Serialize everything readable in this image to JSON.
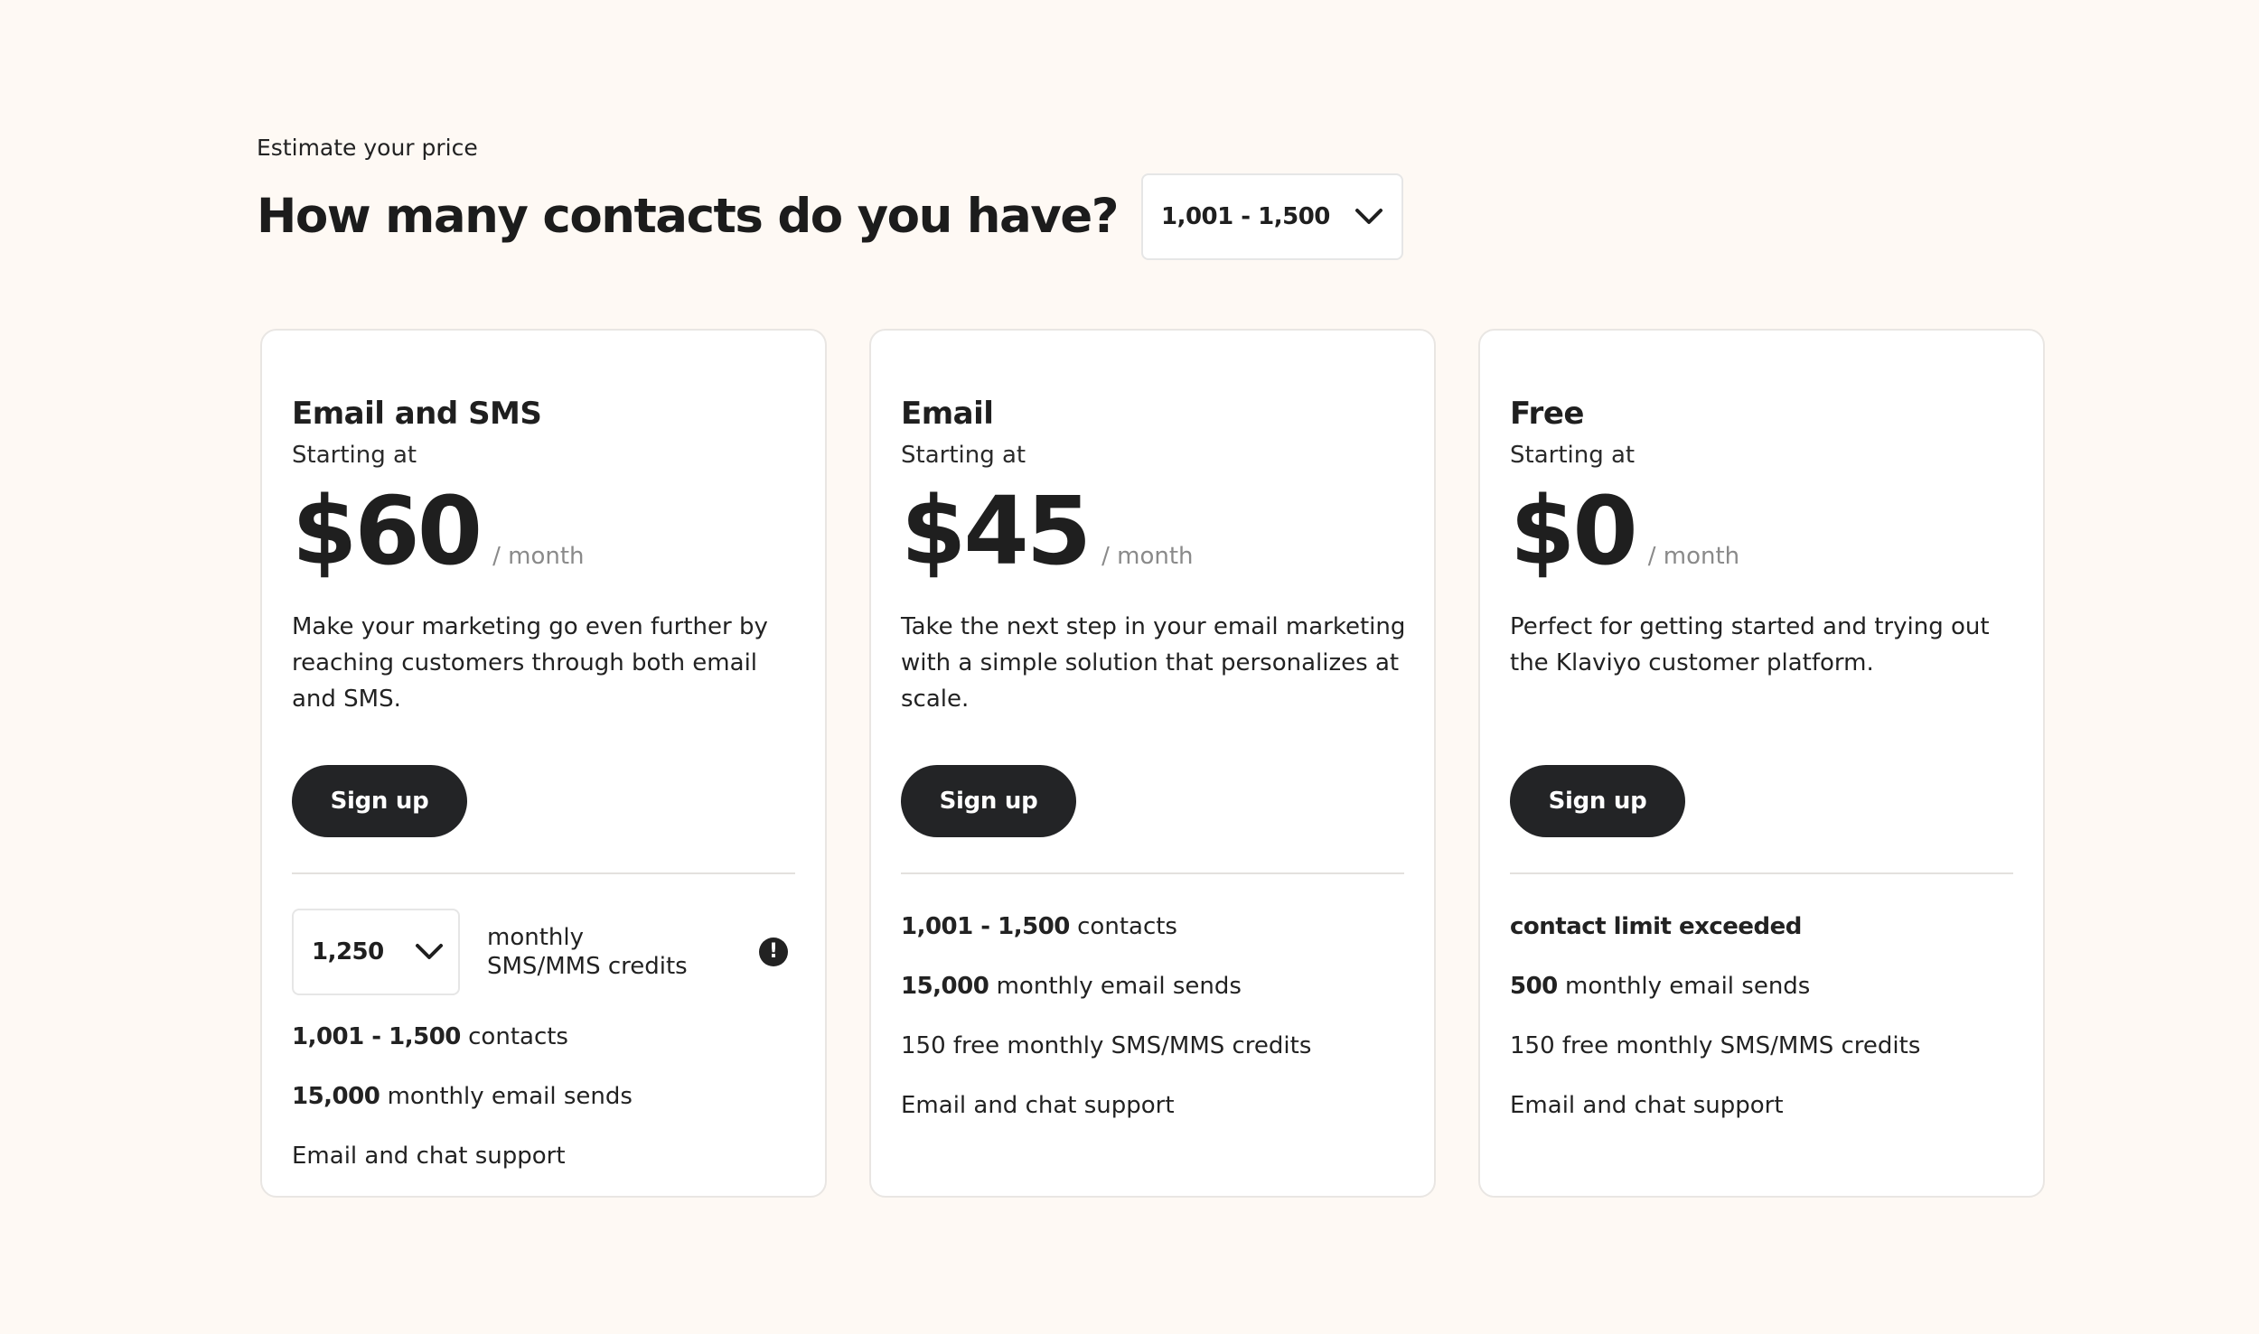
{
  "header": {
    "eyebrow": "Estimate your price",
    "title": "How many contacts do you have?",
    "contacts_select": {
      "value": "1,001 - 1,500",
      "icon": "chevron-down-icon"
    }
  },
  "cards": [
    {
      "name": "Email and SMS",
      "starting": "Starting at",
      "price": "$60",
      "per": "/ month",
      "description": "Make your marketing go even further by reaching customers through both email and SMS.",
      "cta": "Sign up",
      "sms": {
        "value": "1,250",
        "label": "monthly SMS/MMS credits",
        "info_glyph": "!",
        "info_icon": "info-icon"
      },
      "features": [
        {
          "bold": "1,001 - 1,500",
          "text": " contacts"
        },
        {
          "bold": "15,000",
          "text": " monthly email sends"
        },
        {
          "bold": "",
          "text": "Email and chat support"
        }
      ]
    },
    {
      "name": "Email",
      "starting": "Starting at",
      "price": "$45",
      "per": "/ month",
      "description": "Take the next step in your email marketing with a simple solution that personalizes at scale.",
      "cta": "Sign up",
      "features": [
        {
          "bold": "1,001 - 1,500",
          "text": " contacts"
        },
        {
          "bold": "15,000",
          "text": " monthly email sends"
        },
        {
          "bold": "",
          "text": "150 free monthly SMS/MMS credits"
        },
        {
          "bold": "",
          "text": "Email and chat support"
        }
      ]
    },
    {
      "name": "Free",
      "starting": "Starting at",
      "price": "$0",
      "per": "/ month",
      "description": "Perfect for getting started and trying out the Klaviyo customer platform.",
      "cta": "Sign up",
      "features": [
        {
          "bold": "contact limit exceeded",
          "text": ""
        },
        {
          "bold": "500",
          "text": " monthly email sends"
        },
        {
          "bold": "",
          "text": "150 free monthly SMS/MMS credits"
        },
        {
          "bold": "",
          "text": "Email and chat support"
        }
      ]
    }
  ],
  "colors": {
    "page_background": "#fef9f4",
    "card_background": "#ffffff",
    "button_background": "#232426",
    "button_text": "#ffffff",
    "muted_text": "#8a8a8a"
  }
}
